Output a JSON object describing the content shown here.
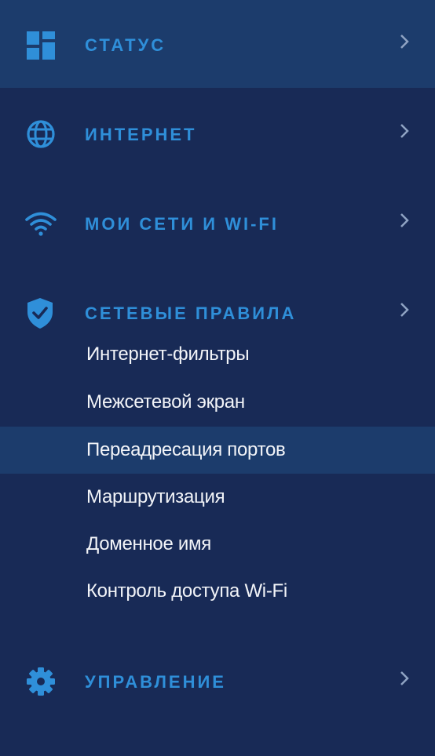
{
  "sidebar": {
    "sections": [
      {
        "label": "СТАТУС",
        "icon": "dashboard-icon",
        "active": true
      },
      {
        "label": "ИНТЕРНЕТ",
        "icon": "globe-icon",
        "active": false
      },
      {
        "label": "МОИ СЕТИ И WI-FI",
        "icon": "wifi-icon",
        "active": false
      },
      {
        "label": "СЕТЕВЫЕ ПРАВИЛА",
        "icon": "shield-check-icon",
        "active": false
      },
      {
        "label": "УПРАВЛЕНИЕ",
        "icon": "gear-icon",
        "active": false
      }
    ],
    "network_rules_items": [
      {
        "label": "Интернет-фильтры",
        "active": false
      },
      {
        "label": "Межсетевой экран",
        "active": false
      },
      {
        "label": "Переадресация портов",
        "active": true
      },
      {
        "label": "Маршрутизация",
        "active": false
      },
      {
        "label": "Доменное имя",
        "active": false
      },
      {
        "label": "Контроль доступа Wi-Fi",
        "active": false
      }
    ]
  },
  "colors": {
    "background": "#182a56",
    "highlight": "#1c3c6c",
    "accent": "#2f8fd9",
    "chevron": "#8fa3c3",
    "sub_text": "#f2f4f8"
  }
}
